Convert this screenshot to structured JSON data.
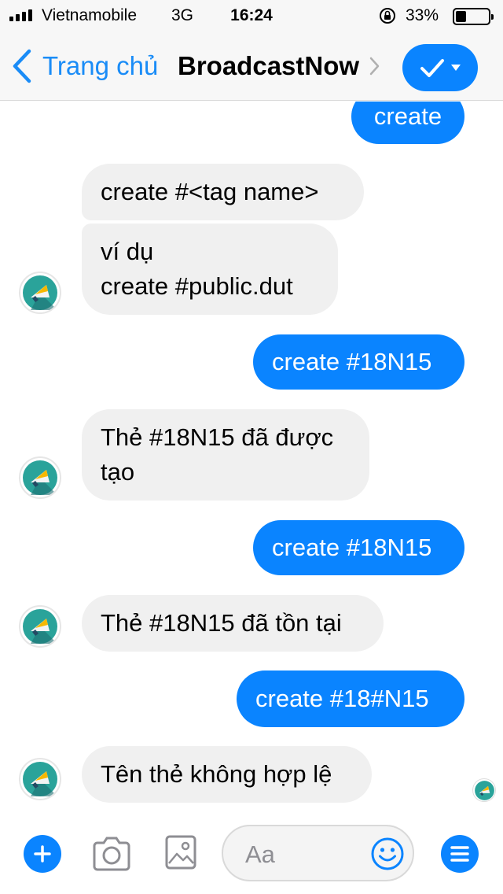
{
  "status_bar": {
    "carrier": "Vietnamobile",
    "network": "3G",
    "time": "16:24",
    "battery_percent": "33%",
    "battery_level": 0.33
  },
  "nav": {
    "back_label": "Trang chủ",
    "title": "BroadcastNow"
  },
  "messages": [
    {
      "direction": "out",
      "text": "create"
    },
    {
      "direction": "in",
      "text": "create #<tag name>"
    },
    {
      "direction": "in",
      "lines": [
        "ví dụ",
        "create #public.dut"
      ]
    },
    {
      "direction": "out",
      "text": "create #18N15"
    },
    {
      "direction": "in",
      "lines": [
        "Thẻ #18N15 đã được",
        "tạo"
      ]
    },
    {
      "direction": "out",
      "text": "create #18N15"
    },
    {
      "direction": "in",
      "text": "Thẻ #18N15 đã tồn tại"
    },
    {
      "direction": "out",
      "text": "create #18#N15"
    },
    {
      "direction": "in",
      "text": "Tên thẻ không hợp lệ"
    }
  ],
  "composer": {
    "placeholder": "Aa"
  },
  "icons": {
    "avatar": "megaphone-logo-icon",
    "add": "plus-icon",
    "camera": "camera-icon",
    "image": "image-icon",
    "emoji": "smiley-icon",
    "menu": "menu-icon",
    "done": "check-icon"
  },
  "colors": {
    "accent": "#0a84ff",
    "incoming_bubble": "#f0f0f0",
    "back_link": "#1a8cf7"
  }
}
